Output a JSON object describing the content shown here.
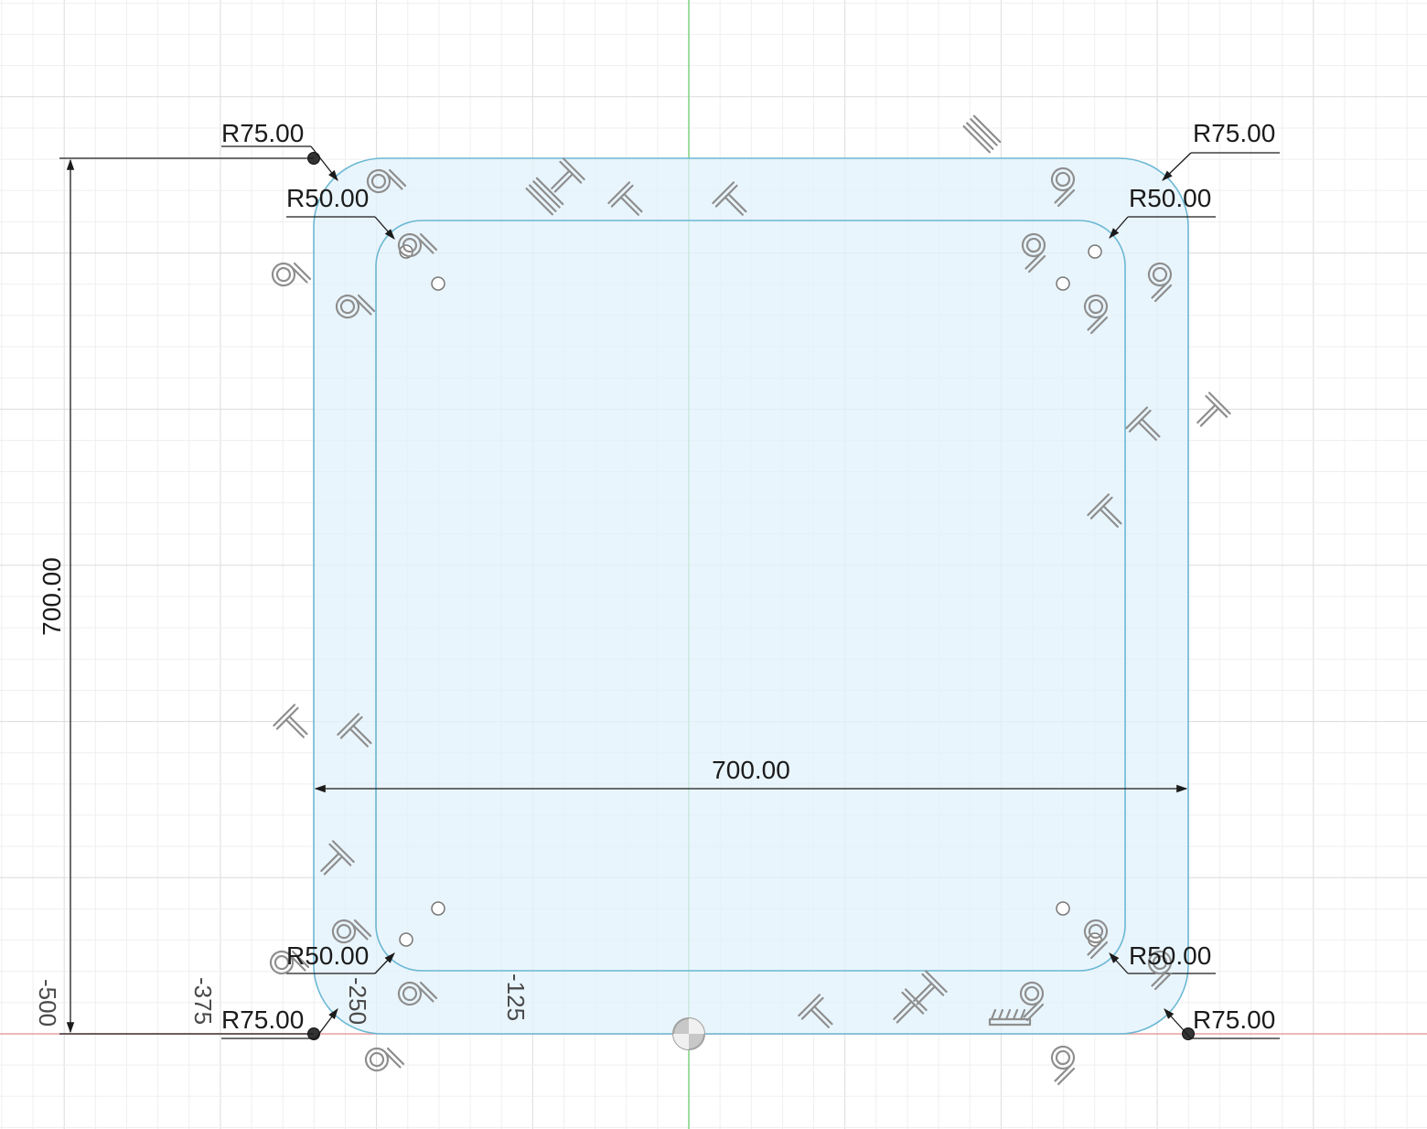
{
  "sketch": {
    "colors": {
      "grid_major": "#dcdcdc",
      "grid_minor": "#efefef",
      "profile_fill": "#e2f2fb",
      "profile_line": "#6bb8d4",
      "x_axis": "#e8a0a0",
      "y_axis": "#7fd27f",
      "dimension": "#1b1b1b"
    },
    "dimensions": {
      "outer_radius_tl": "R75.00",
      "outer_radius_tr": "R75.00",
      "outer_radius_bl": "R75.00",
      "outer_radius_br": "R75.00",
      "inner_radius_tl": "R50.00",
      "inner_radius_tr": "R50.00",
      "inner_radius_bl": "R50.00",
      "inner_radius_br": "R50.00",
      "width": "700.00",
      "height": "700.00"
    },
    "ruler_labels": [
      "-500",
      "-375",
      "-250",
      "-125"
    ],
    "constraint_icons": [
      "tangent-icon",
      "horizontal-icon",
      "vertical-icon",
      "parallel-icon",
      "fix-icon"
    ]
  }
}
